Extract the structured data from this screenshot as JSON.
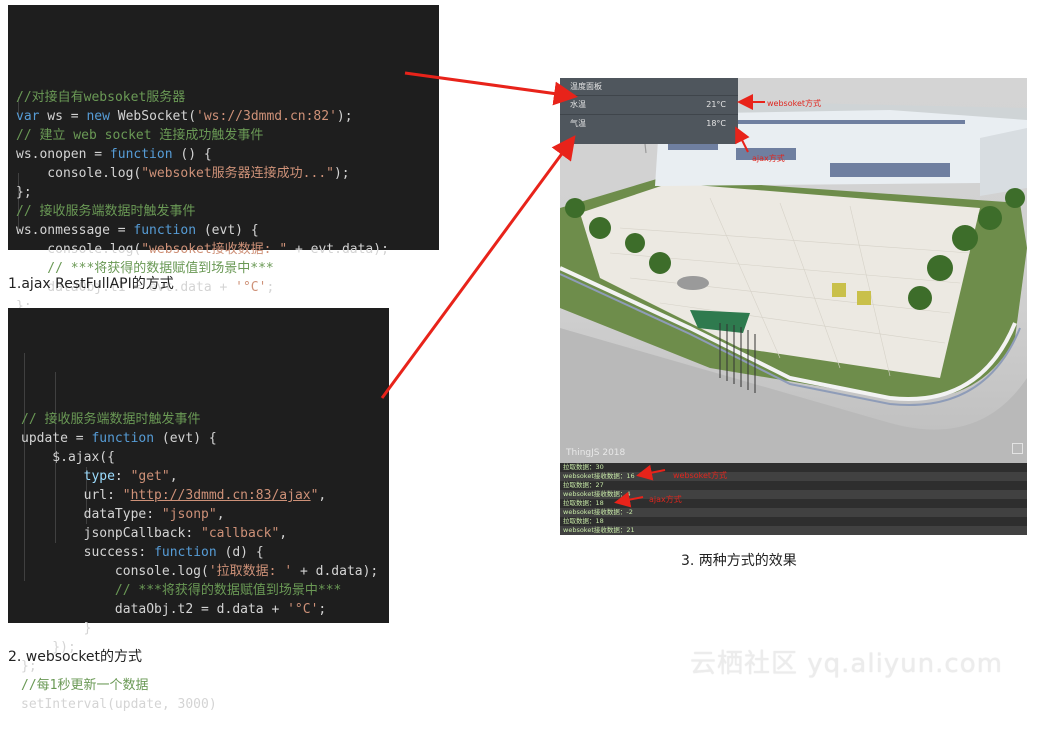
{
  "code_block_1": {
    "lines": [
      {
        "parts": [
          [
            "c",
            "//对接自有websoket服务器"
          ]
        ]
      },
      {
        "parts": [
          [
            "k",
            "var"
          ],
          [
            "t",
            " ws = "
          ],
          [
            "k",
            "new"
          ],
          [
            "t",
            " WebSocket("
          ],
          [
            "s",
            "'ws://3dmmd.cn:82'"
          ],
          [
            "t",
            ");"
          ]
        ]
      },
      {
        "parts": [
          [
            "c",
            "// 建立 web socket 连接成功触发事件"
          ]
        ]
      },
      {
        "parts": [
          [
            "t",
            "ws.onopen = "
          ],
          [
            "k",
            "function"
          ],
          [
            "t",
            " () {"
          ]
        ]
      },
      {
        "parts": [
          [
            "t",
            "    console.log("
          ],
          [
            "s",
            "\"websoket服务器连接成功...\""
          ],
          [
            "t",
            ");"
          ]
        ]
      },
      {
        "parts": [
          [
            "t",
            "};"
          ]
        ]
      },
      {
        "parts": [
          [
            "c",
            "// 接收服务端数据时触发事件"
          ]
        ]
      },
      {
        "parts": [
          [
            "t",
            "ws.onmessage = "
          ],
          [
            "k",
            "function"
          ],
          [
            "t",
            " (evt) {"
          ]
        ]
      },
      {
        "parts": [
          [
            "t",
            "    console.log("
          ],
          [
            "s",
            "\"websoket接收数据: \""
          ],
          [
            "t",
            " + evt.data);"
          ]
        ]
      },
      {
        "parts": [
          [
            "c",
            "    // ***将获得的数据赋值到场景中***"
          ]
        ]
      },
      {
        "parts": [
          [
            "t",
            "    dataObj.t1 = evt.data + "
          ],
          [
            "s",
            "'°C'"
          ],
          [
            "t",
            ";"
          ]
        ]
      },
      {
        "parts": [
          [
            "t",
            "};"
          ]
        ]
      }
    ]
  },
  "caption_1": "1.ajax RestFullAPI的方式",
  "code_block_2": {
    "lines": [
      {
        "parts": [
          [
            "c",
            "// 接收服务端数据时触发事件"
          ]
        ]
      },
      {
        "parts": [
          [
            "t",
            "update = "
          ],
          [
            "k",
            "function"
          ],
          [
            "t",
            " (evt) {"
          ]
        ]
      },
      {
        "parts": [
          [
            "t",
            "    $.ajax({"
          ]
        ]
      },
      {
        "parts": [
          [
            "p",
            "        type"
          ],
          [
            "t",
            ": "
          ],
          [
            "s",
            "\"get\""
          ],
          [
            "t",
            ","
          ]
        ]
      },
      {
        "parts": [
          [
            "t",
            "        url: "
          ],
          [
            "s",
            "\""
          ],
          [
            "su",
            "http://3dmmd.cn:83/ajax"
          ],
          [
            "s",
            "\""
          ],
          [
            "t",
            ","
          ]
        ]
      },
      {
        "parts": [
          [
            "t",
            "        dataType: "
          ],
          [
            "s",
            "\"jsonp\""
          ],
          [
            "t",
            ","
          ]
        ]
      },
      {
        "parts": [
          [
            "t",
            "        jsonpCallback: "
          ],
          [
            "s",
            "\"callback\""
          ],
          [
            "t",
            ","
          ]
        ]
      },
      {
        "parts": [
          [
            "t",
            "        success: "
          ],
          [
            "k",
            "function"
          ],
          [
            "t",
            " (d) {"
          ]
        ]
      },
      {
        "parts": [
          [
            "t",
            "            console.log("
          ],
          [
            "s",
            "'拉取数据: '"
          ],
          [
            "t",
            " + d.data);"
          ]
        ]
      },
      {
        "parts": [
          [
            "c",
            "            // ***将获得的数据赋值到场景中***"
          ]
        ]
      },
      {
        "parts": [
          [
            "t",
            "            dataObj.t2 = d.data + "
          ],
          [
            "s",
            "'°C'"
          ],
          [
            "t",
            ";"
          ]
        ]
      },
      {
        "parts": [
          [
            "t",
            "        }"
          ]
        ]
      },
      {
        "parts": [
          [
            "t",
            "    });"
          ]
        ]
      },
      {
        "parts": [
          [
            "t",
            "};"
          ]
        ]
      },
      {
        "parts": [
          [
            "c",
            "//每1秒更新一个数据"
          ]
        ]
      },
      {
        "parts": [
          [
            "t",
            "setInterval(update, 3000)"
          ]
        ]
      }
    ]
  },
  "caption_2": "2. websocket的方式",
  "caption_3": "3. 两种方式的效果",
  "scene": {
    "panel": {
      "title": "温度面板",
      "rows": [
        {
          "label": "水温",
          "value": "21°C"
        },
        {
          "label": "气温",
          "value": "18°C"
        }
      ]
    },
    "annotations": {
      "websocket": "websoket方式",
      "ajax": "ajax方式",
      "log_websocket": "websoket方式",
      "log_ajax": "ajax方式"
    },
    "brand": "ThingJS 2018",
    "log_rows": [
      "拉取数据：30",
      "websoket接收数据：16",
      "拉取数据：27",
      "websoket接收数据：4",
      "拉取数据：18",
      "websoket接收数据：-2",
      "拉取数据：18",
      "websoket接收数据：21"
    ]
  },
  "watermark": "云栖社区 yq.aliyun.com",
  "colors": {
    "code_bg": "#1e1e1e",
    "comment": "#6a9955",
    "keyword": "#569cd6",
    "string": "#ce9178",
    "arrow": "#e8231a",
    "panel_bg": "#4f565d"
  }
}
